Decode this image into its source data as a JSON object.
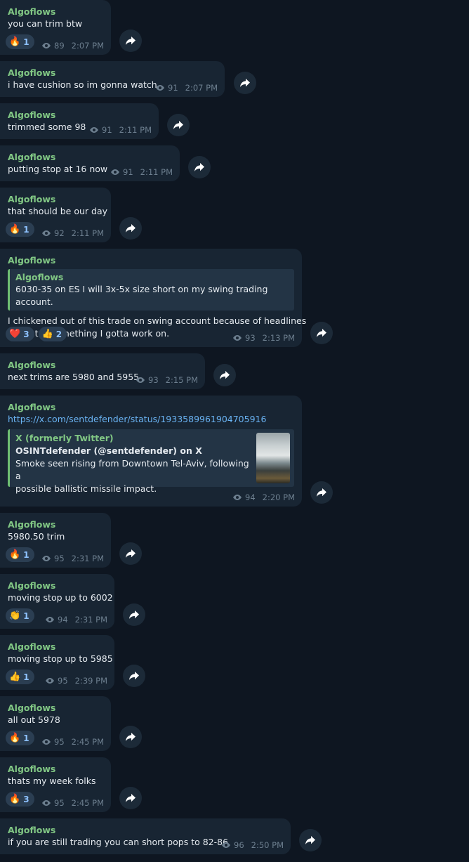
{
  "messages": [
    {
      "sender": "Algoflows",
      "text": "you can trim btw",
      "views": "89",
      "time": "2:07 PM",
      "reactions": [
        {
          "emoji": "🔥",
          "count": "1"
        }
      ]
    },
    {
      "sender": "Algoflows",
      "text": "i have cushion so im gonna watch",
      "views": "91",
      "time": "2:07 PM",
      "reactions": []
    },
    {
      "sender": "Algoflows",
      "text": "trimmed some 98",
      "views": "91",
      "time": "2:11 PM",
      "reactions": []
    },
    {
      "sender": "Algoflows",
      "text": "putting stop at 16 now",
      "views": "91",
      "time": "2:11 PM",
      "reactions": []
    },
    {
      "sender": "Algoflows",
      "text": "that should be our day",
      "views": "92",
      "time": "2:11 PM",
      "reactions": [
        {
          "emoji": "🔥",
          "count": "1"
        }
      ]
    },
    {
      "sender": "Algoflows",
      "quote": {
        "name": "Algoflows",
        "text": "6030-35 on ES I will 3x-5x size short on my swing trading account."
      },
      "text_lines": [
        "I chickened out of this trade on swing account because of headlines",
        "so that is something I gotta work on."
      ],
      "views": "93",
      "time": "2:13 PM",
      "reactions": [
        {
          "emoji": "❤️",
          "count": "3"
        },
        {
          "emoji": "👍",
          "count": "2"
        }
      ]
    },
    {
      "sender": "Algoflows",
      "text": "next trims are 5980 and 5955",
      "views": "93",
      "time": "2:15 PM",
      "reactions": []
    },
    {
      "sender": "Algoflows",
      "link": "https://x.com/sentdefender/status/1933589961904705916",
      "preview": {
        "site": "X (formerly Twitter)",
        "title": "OSINTdefender (@sentdefender) on X",
        "desc_lines": [
          "Smoke seen rising from Downtown Tel-Aviv, following a",
          "possible ballistic missile impact."
        ]
      },
      "views": "94",
      "time": "2:20 PM",
      "reactions": []
    },
    {
      "sender": "Algoflows",
      "text": "5980.50 trim",
      "views": "95",
      "time": "2:31 PM",
      "reactions": [
        {
          "emoji": "🔥",
          "count": "1"
        }
      ]
    },
    {
      "sender": "Algoflows",
      "text": "moving stop up to 6002",
      "views": "94",
      "time": "2:31 PM",
      "reactions": [
        {
          "emoji": "👏",
          "count": "1"
        }
      ]
    },
    {
      "sender": "Algoflows",
      "text": "moving stop up to 5985",
      "views": "95",
      "time": "2:39 PM",
      "reactions": [
        {
          "emoji": "👍",
          "count": "1"
        }
      ]
    },
    {
      "sender": "Algoflows",
      "text": "all out 5978",
      "views": "95",
      "time": "2:45 PM",
      "reactions": [
        {
          "emoji": "🔥",
          "count": "1"
        }
      ]
    },
    {
      "sender": "Algoflows",
      "text": "thats my week folks",
      "views": "95",
      "time": "2:45 PM",
      "reactions": [
        {
          "emoji": "🔥",
          "count": "3"
        }
      ]
    },
    {
      "sender": "Algoflows",
      "text": "if you are still trading you can short pops to 82-86",
      "views": "96",
      "time": "2:50 PM",
      "reactions": []
    }
  ]
}
